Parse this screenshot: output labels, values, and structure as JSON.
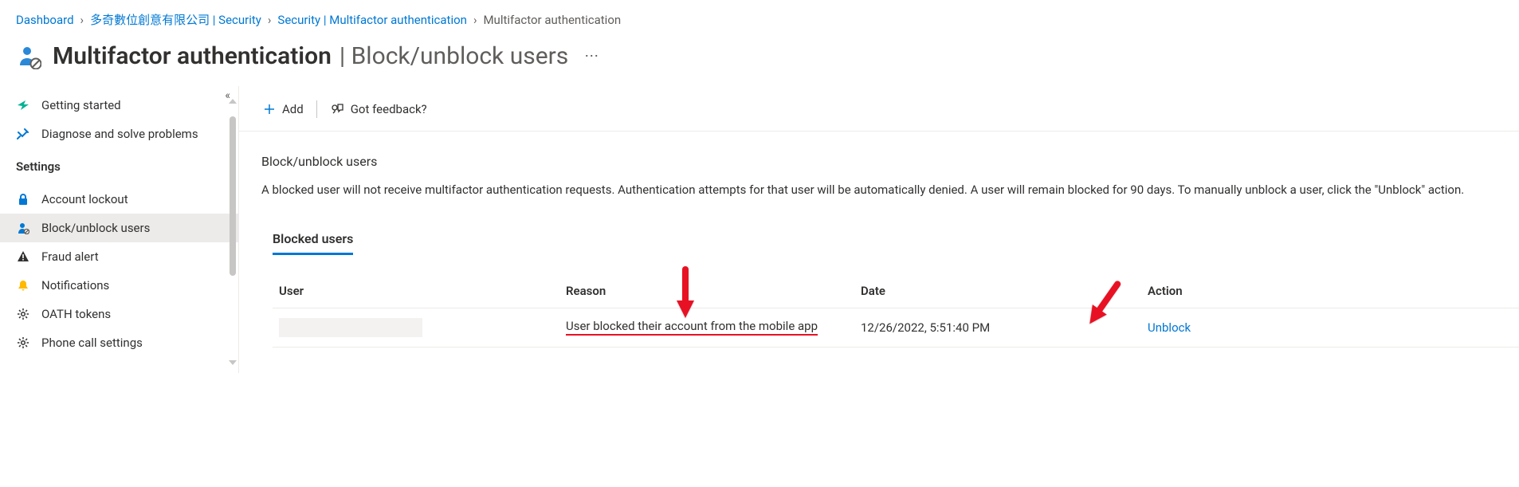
{
  "breadcrumb": [
    {
      "label": "Dashboard"
    },
    {
      "label": "多奇數位創意有限公司 | Security"
    },
    {
      "label": "Security | Multifactor authentication"
    },
    {
      "label": "Multifactor authentication"
    }
  ],
  "header": {
    "title": "Multifactor authentication",
    "subtitle": "| Block/unblock users"
  },
  "toolbar": {
    "add": "Add",
    "feedback": "Got feedback?"
  },
  "sidebar": {
    "items_top": [
      {
        "label": "Getting started"
      },
      {
        "label": "Diagnose and solve problems"
      }
    ],
    "group_title": "Settings",
    "items_settings": [
      {
        "label": "Account lockout"
      },
      {
        "label": "Block/unblock users"
      },
      {
        "label": "Fraud alert"
      },
      {
        "label": "Notifications"
      },
      {
        "label": "OATH tokens"
      },
      {
        "label": "Phone call settings"
      }
    ]
  },
  "content": {
    "heading": "Block/unblock users",
    "description": "A blocked user will not receive multifactor authentication requests. Authentication attempts for that user will be automatically denied. A user will remain blocked for 90 days. To manually unblock a user, click the \"Unblock\" action.",
    "tab": "Blocked users",
    "columns": {
      "user": "User",
      "reason": "Reason",
      "date": "Date",
      "action": "Action"
    },
    "row": {
      "user": "",
      "reason": "User blocked their account from the mobile app",
      "date": "12/26/2022, 5:51:40 PM",
      "action": "Unblock"
    }
  }
}
